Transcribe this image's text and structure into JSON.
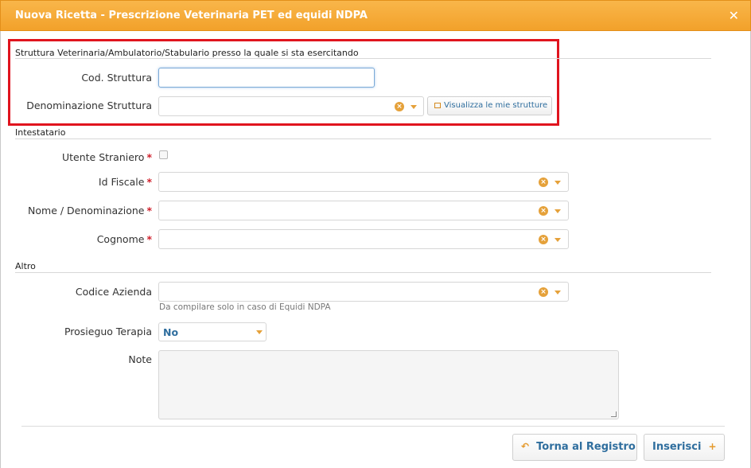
{
  "dialog": {
    "title": "Nuova Ricetta - Prescrizione Veterinaria PET ed equidi NDPA",
    "close_glyph": "✕"
  },
  "struttura": {
    "section_title": "Struttura Veterinaria/Ambulatorio/Stabulario presso la quale si sta esercitando",
    "cod_label": "Cod. Struttura",
    "cod_value": "",
    "denominazione_label": "Denominazione Struttura",
    "denominazione_value": "",
    "visualizza_button": "Visualizza le mie strutture"
  },
  "intestatario": {
    "section_title": "Intestatario",
    "utente_straniero_label": "Utente Straniero",
    "id_fiscale_label": "Id Fiscale",
    "nome_label": "Nome / Denominazione",
    "cognome_label": "Cognome",
    "required_mark": "*"
  },
  "altro": {
    "section_title": "Altro",
    "codice_azienda_label": "Codice Azienda",
    "codice_azienda_hint": "Da compilare solo in caso di Equidi NDPA",
    "prosieguo_label": "Prosieguo Terapia",
    "prosieguo_value": "No",
    "note_label": "Note"
  },
  "footer": {
    "torna_label": "Torna al Registro",
    "inserisci_label": "Inserisci"
  },
  "icons": {
    "clear": "clear-icon",
    "caret": "chevron-down-icon",
    "back": "undo-icon",
    "plus": "plus-icon"
  },
  "colors": {
    "titlebar": "#f2a12a",
    "highlight": "#e0141e",
    "accent": "#e5a13a",
    "link": "#2f6e9e",
    "required": "#d0202c"
  }
}
